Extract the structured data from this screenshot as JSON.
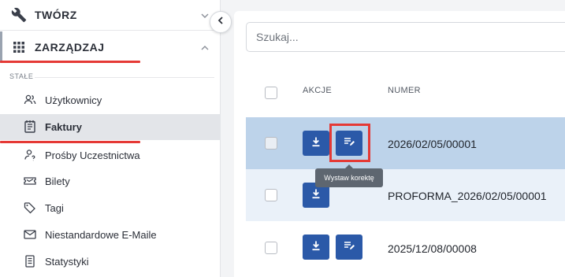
{
  "sidebar": {
    "tworz_label": "TWÓRZ",
    "zarzadzaj_label": "ZARZĄDZAJ",
    "section_label": "STAŁE",
    "items": [
      {
        "label": "Użytkownicy",
        "icon": "users-icon"
      },
      {
        "label": "Faktury",
        "icon": "invoice-icon"
      },
      {
        "label": "Prośby Uczestnictwa",
        "icon": "user-request-icon"
      },
      {
        "label": "Bilety",
        "icon": "ticket-icon"
      },
      {
        "label": "Tagi",
        "icon": "tag-icon"
      },
      {
        "label": "Niestandardowe E-Maile",
        "icon": "mail-icon"
      },
      {
        "label": "Statystyki",
        "icon": "stats-icon"
      }
    ],
    "active_item": "Faktury"
  },
  "search": {
    "placeholder": "Szukaj..."
  },
  "table": {
    "headers": {
      "actions": "AKCJE",
      "number": "NUMER"
    },
    "rows": [
      {
        "number": "2026/02/05/00001"
      },
      {
        "number": "PROFORMA_2026/02/05/00001"
      },
      {
        "number": "2025/12/08/00008"
      }
    ]
  },
  "tooltip": {
    "text": "Wystaw korektę"
  },
  "colors": {
    "accent_button": "#2b59a8",
    "selected_row": "#bdd3ea",
    "hover_row": "#eaf1f9",
    "highlight": "#e53935"
  }
}
